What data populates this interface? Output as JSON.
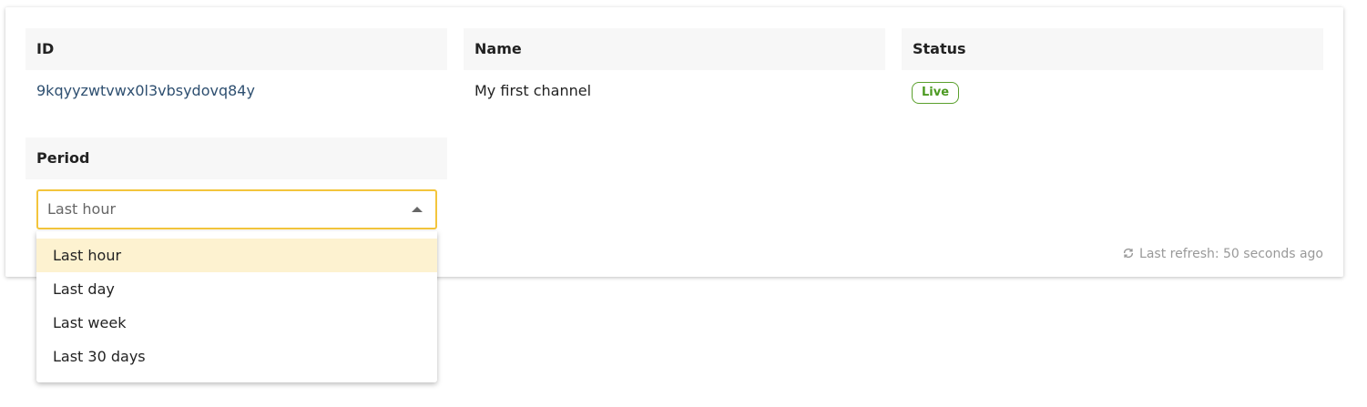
{
  "table": {
    "headers": {
      "id": "ID",
      "name": "Name",
      "status": "Status"
    },
    "row": {
      "id": "9kqyyzwtvwx0l3vbsydovq84y",
      "name": "My first channel",
      "status": "Live"
    }
  },
  "period": {
    "label": "Period",
    "selected": "Last hour",
    "options": [
      "Last hour",
      "Last day",
      "Last week",
      "Last 30 days"
    ]
  },
  "refresh": {
    "icon": "refresh-icon",
    "text": "Last refresh: 50 seconds ago"
  },
  "colors": {
    "status_live": "#5aa02c",
    "select_focus_border": "#f3c53c",
    "option_highlight": "#fdf2d0",
    "id_text": "#2e4f70"
  }
}
